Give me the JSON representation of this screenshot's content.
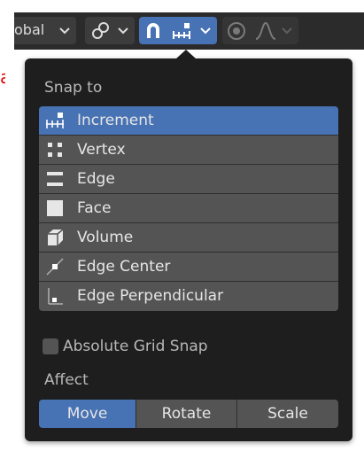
{
  "toolbar": {
    "orientation_label": "obal"
  },
  "popup": {
    "snap_to_label": "Snap to",
    "snap_items": [
      {
        "label": "Increment",
        "icon": "increment-icon",
        "selected": true
      },
      {
        "label": "Vertex",
        "icon": "vertex-icon",
        "selected": false
      },
      {
        "label": "Edge",
        "icon": "edge-icon",
        "selected": false
      },
      {
        "label": "Face",
        "icon": "face-icon",
        "selected": false
      },
      {
        "label": "Volume",
        "icon": "volume-icon",
        "selected": false
      },
      {
        "label": "Edge Center",
        "icon": "edge-center-icon",
        "selected": false
      },
      {
        "label": "Edge Perpendicular",
        "icon": "edge-perpendicular-icon",
        "selected": false
      }
    ],
    "absolute_grid_snap_label": "Absolute Grid Snap",
    "absolute_grid_snap_checked": false,
    "affect_label": "Affect",
    "affect_options": [
      {
        "label": "Move",
        "active": true
      },
      {
        "label": "Rotate",
        "active": false
      },
      {
        "label": "Scale",
        "active": false
      }
    ]
  },
  "colors": {
    "accent": "#4772b3",
    "panel_bg": "#1e1e1e",
    "item_bg": "#545454",
    "toolbar_bg": "#2b2b2b",
    "annotation_red": "#e00000"
  }
}
